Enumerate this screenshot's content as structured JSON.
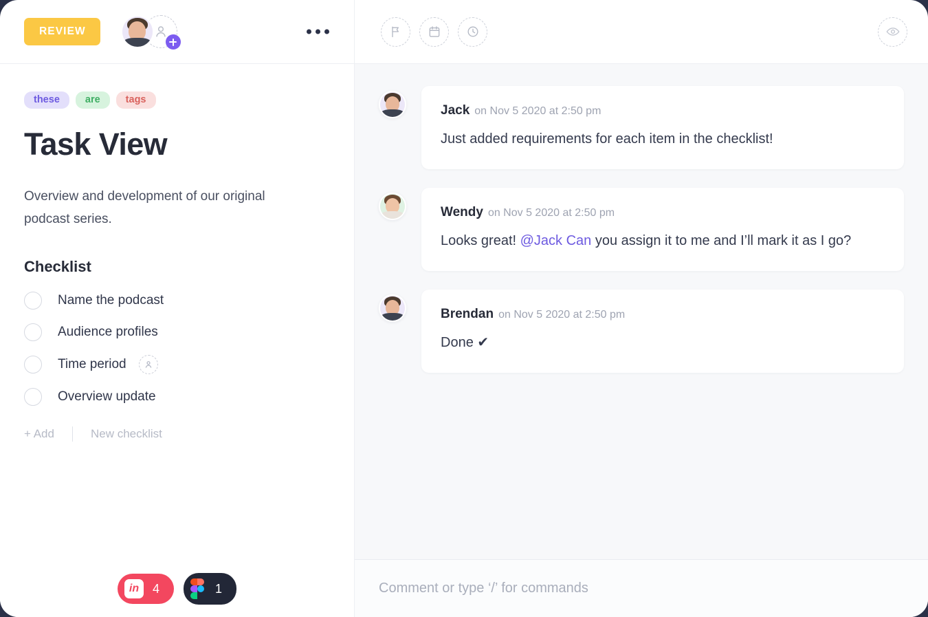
{
  "topbar": {
    "status_label": "REVIEW",
    "status_color": "#fbc844",
    "menu_icon": "more-horizontal-icon",
    "assignee_avatar": "jack-avatar",
    "add_person_label": "+",
    "tools": [
      {
        "name": "flag-icon",
        "label": "Priority"
      },
      {
        "name": "calendar-icon",
        "label": "Due date"
      },
      {
        "name": "clock-icon",
        "label": "Time estimate"
      }
    ],
    "watch_icon": "eye-icon"
  },
  "task": {
    "tags": [
      {
        "label": "these",
        "bg": "#e3dffb",
        "color": "#6d5ae0"
      },
      {
        "label": "are",
        "bg": "#d7f3de",
        "color": "#3fae63"
      },
      {
        "label": "tags",
        "bg": "#fadfde",
        "color": "#d9625d"
      }
    ],
    "title": "Task View",
    "description": "Overview and development of our original podcast series.",
    "checklist_title": "Checklist",
    "checklist": [
      {
        "label": "Name the podcast",
        "checked": false,
        "assignee": false
      },
      {
        "label": "Audience profiles",
        "checked": false,
        "assignee": false
      },
      {
        "label": "Time period",
        "checked": false,
        "assignee": true
      },
      {
        "label": "Overview update",
        "checked": false,
        "assignee": false
      }
    ],
    "add_label": "+ Add",
    "new_checklist_label": "New checklist"
  },
  "badges": [
    {
      "app": "invision",
      "glyph": "in",
      "count": "4",
      "bg": "#f3475f"
    },
    {
      "app": "figma",
      "glyph": "figma-logo",
      "count": "1",
      "bg": "#222737"
    }
  ],
  "comments": [
    {
      "author": "Jack",
      "time": "on Nov 5 2020 at 2:50 pm",
      "avatar": "male",
      "text_before": "Just added requirements for each item in the checklist!",
      "mention": "",
      "text_after": ""
    },
    {
      "author": "Wendy",
      "time": "on Nov 5 2020 at 2:50 pm",
      "avatar": "female",
      "text_before": "Looks great! ",
      "mention": "@Jack Can",
      "text_after": " you assign it to me and I’ll mark it as I go?"
    },
    {
      "author": "Brendan",
      "time": "on Nov 5 2020 at 2:50 pm",
      "avatar": "male",
      "text_before": "Done ✔",
      "mention": "",
      "text_after": ""
    }
  ],
  "composer": {
    "placeholder": "Comment or type ‘/’ for commands"
  }
}
